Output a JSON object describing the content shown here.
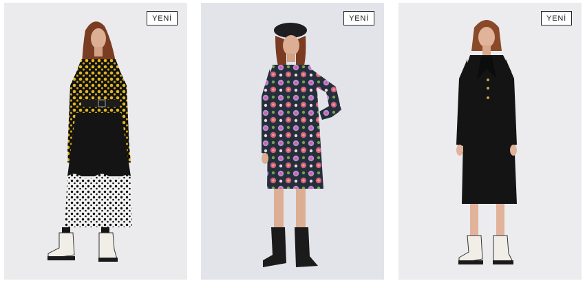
{
  "products": [
    {
      "badge": "YENİ",
      "colors": {
        "bg": "#ebebed"
      }
    },
    {
      "badge": "YENİ",
      "colors": {
        "bg": "#e3e4e9"
      }
    },
    {
      "badge": "YENİ",
      "colors": {
        "bg": "#ececee"
      }
    }
  ]
}
